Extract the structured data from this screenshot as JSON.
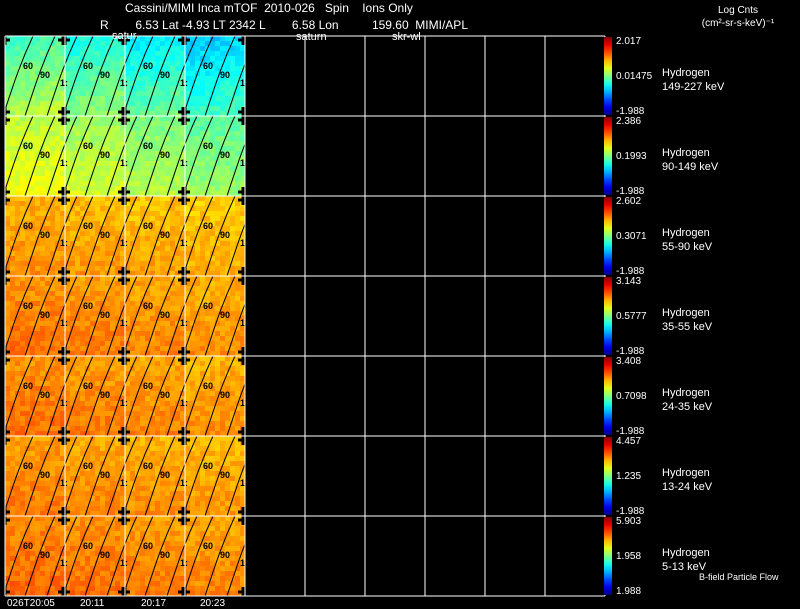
{
  "header": {
    "title": "Cassini/MIMI Inca mTOF  2010-026   Spin    Ions Only",
    "info": "R        6.53 Lat -4.93 LT 2342 L        6.58 Lon          159.60  MIMI/APL",
    "overlay_labels": [
      "satur",
      "saturn",
      "skr-wl"
    ]
  },
  "colorbar": {
    "title_line1": "Log Cnts",
    "title_line2": "(cm²-sr-s-keV)⁻¹"
  },
  "chart_data": {
    "type": "heatmap",
    "title": "Cassini/MIMI Inca mTOF  2010-026   Spin    Ions Only",
    "time_labels": [
      "026T20:05",
      "20:11",
      "20:17",
      "20:23"
    ],
    "panels_filled": 4,
    "panels_total": 10,
    "contour_labels": [
      "60",
      "90",
      "1:"
    ],
    "rows": [
      {
        "species": "Hydrogen",
        "energy": "149-227 keV",
        "max": "2.017",
        "mid": "0.01475",
        "min": "-1.988",
        "level": 0.45
      },
      {
        "species": "Hydrogen",
        "energy": "90-149 keV",
        "max": "2.386",
        "mid": "0.1993",
        "min": "-1.988",
        "level": 0.55
      },
      {
        "species": "Hydrogen",
        "energy": "55-90 keV",
        "max": "2.602",
        "mid": "0.3071",
        "min": "-1.988",
        "level": 0.72
      },
      {
        "species": "Hydrogen",
        "energy": "35-55 keV",
        "max": "3.143",
        "mid": "0.5777",
        "min": "-1.988",
        "level": 0.75
      },
      {
        "species": "Hydrogen",
        "energy": "24-35 keV",
        "max": "3.408",
        "mid": "0.7098",
        "min": "-1.988",
        "level": 0.75
      },
      {
        "species": "Hydrogen",
        "energy": "13-24 keV",
        "max": "4.457",
        "mid": "1.235",
        "min": "-1.988",
        "level": 0.74
      },
      {
        "species": "Hydrogen",
        "energy": "5-13 keV",
        "max": "5.903",
        "mid": "1.958",
        "min": "1.988",
        "level": 0.76
      }
    ],
    "footer_label": "B-field Particle Flow"
  }
}
